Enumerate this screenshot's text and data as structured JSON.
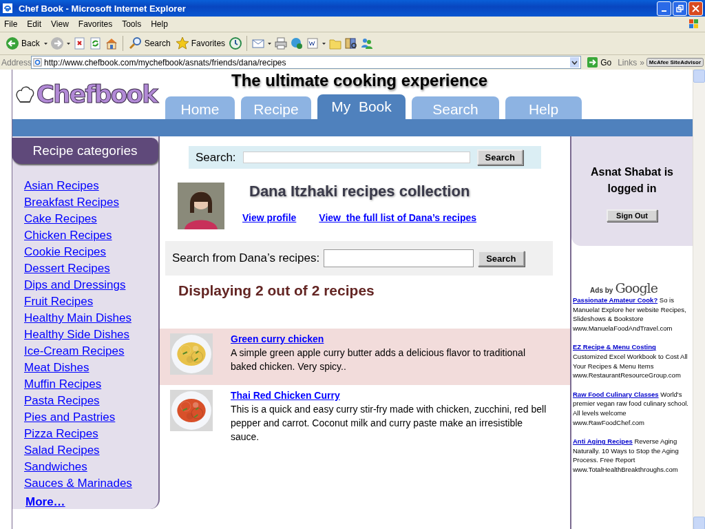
{
  "window": {
    "title": "Chef Book - Microsoft Internet Explorer"
  },
  "menu": [
    "File",
    "Edit",
    "View",
    "Favorites",
    "Tools",
    "Help"
  ],
  "toolbar": [
    {
      "kind": "back",
      "label": "Back"
    },
    {
      "kind": "caret"
    },
    {
      "kind": "forward"
    },
    {
      "kind": "caret"
    },
    {
      "kind": "stop"
    },
    {
      "kind": "refresh"
    },
    {
      "kind": "home"
    },
    {
      "kind": "sep"
    },
    {
      "kind": "search",
      "label": "Search"
    },
    {
      "kind": "favorites",
      "label": "Favorites"
    },
    {
      "kind": "history"
    },
    {
      "kind": "sep"
    },
    {
      "kind": "mail"
    },
    {
      "kind": "caret"
    },
    {
      "kind": "print"
    },
    {
      "kind": "messenger"
    },
    {
      "kind": "word"
    },
    {
      "kind": "caret"
    },
    {
      "kind": "folder"
    },
    {
      "kind": "research"
    },
    {
      "kind": "people"
    }
  ],
  "address": {
    "label": "Address",
    "url": "http://www.chefbook.com/mychefbook/asnats/friends/dana/recipes",
    "go": "Go",
    "links": "Links",
    "chevron": "»",
    "addon": "McAfee SiteAdvisor"
  },
  "site": {
    "logo": "Chefbook",
    "tagline": "The ultimate cooking experience",
    "tabs": [
      {
        "label": "Home",
        "selected": false
      },
      {
        "label": "Recipe",
        "selected": false
      },
      {
        "label": "My  Book",
        "selected": true
      },
      {
        "label": "Search",
        "selected": false
      },
      {
        "label": "Help",
        "selected": false
      }
    ]
  },
  "categories": {
    "title": "Recipe categories",
    "items": [
      "Asian Recipes",
      "Breakfast Recipes",
      "Cake Recipes",
      "Chicken Recipes",
      "Cookie Recipes",
      "Dessert Recipes",
      "Dips and Dressings",
      "Fruit Recipes",
      "Healthy Main Dishes",
      "Healthy Side Dishes",
      "Ice-Cream Recipes",
      "Meat Dishes",
      "Muffin Recipes",
      "Pasta Recipes",
      "Pies and Pastries",
      "Pizza Recipes",
      "Salad Recipes",
      "Sandwiches",
      "Sauces & Marinades"
    ],
    "more": "More…"
  },
  "search": {
    "label": "Search:",
    "button": "Search"
  },
  "profile": {
    "heading": "Dana Itzhaki recipes collection",
    "links": [
      "View profile",
      "View  the full list of Dana’s recipes"
    ]
  },
  "friend_search": {
    "label": "Search from Dana’s recipes:",
    "button": "Search"
  },
  "result_count": "Displaying 2 out of 2 recipes",
  "recipes": [
    {
      "title": "Green curry chicken",
      "description": "A simple green apple curry butter adds a delicious flavor to traditional baked chicken. Very spicy..",
      "highlighted": true
    },
    {
      "title": "Thai Red Chicken Curry",
      "description": "This is a quick and easy curry stir-fry made with chicken, zucchini, red bell pepper and carrot. Coconut milk and curry paste make an irresistible sauce.",
      "highlighted": false
    }
  ],
  "user": {
    "status": "Asnat Shabat is logged in",
    "button": "Sign Out"
  },
  "ads": {
    "label": "Ads by",
    "brand": "Google",
    "items": [
      {
        "title": "Passionate Amateur Cook?",
        "text": "So is Manuela! Explore her website Recipes, Slideshows & Bookstore",
        "url": "www.ManuelaFoodAndTravel.com"
      },
      {
        "title": "EZ Recipe & Menu Costing",
        "text": "Customized Excel Workbook to Cost All Your Recipes & Menu Items",
        "url": "www.RestaurantResourceGroup.com"
      },
      {
        "title": "Raw Food Culinary Classes",
        "text": "World's premier vegan raw food culinary school. All levels welcome",
        "url": "www.RawFoodChef.com"
      },
      {
        "title": "Anti Aging Recipes",
        "text": "Reverse Aging Naturally. 10 Ways to Stop the Aging Process. Free Report",
        "url": "www.TotalHealthBreakthroughs.com"
      }
    ]
  }
}
